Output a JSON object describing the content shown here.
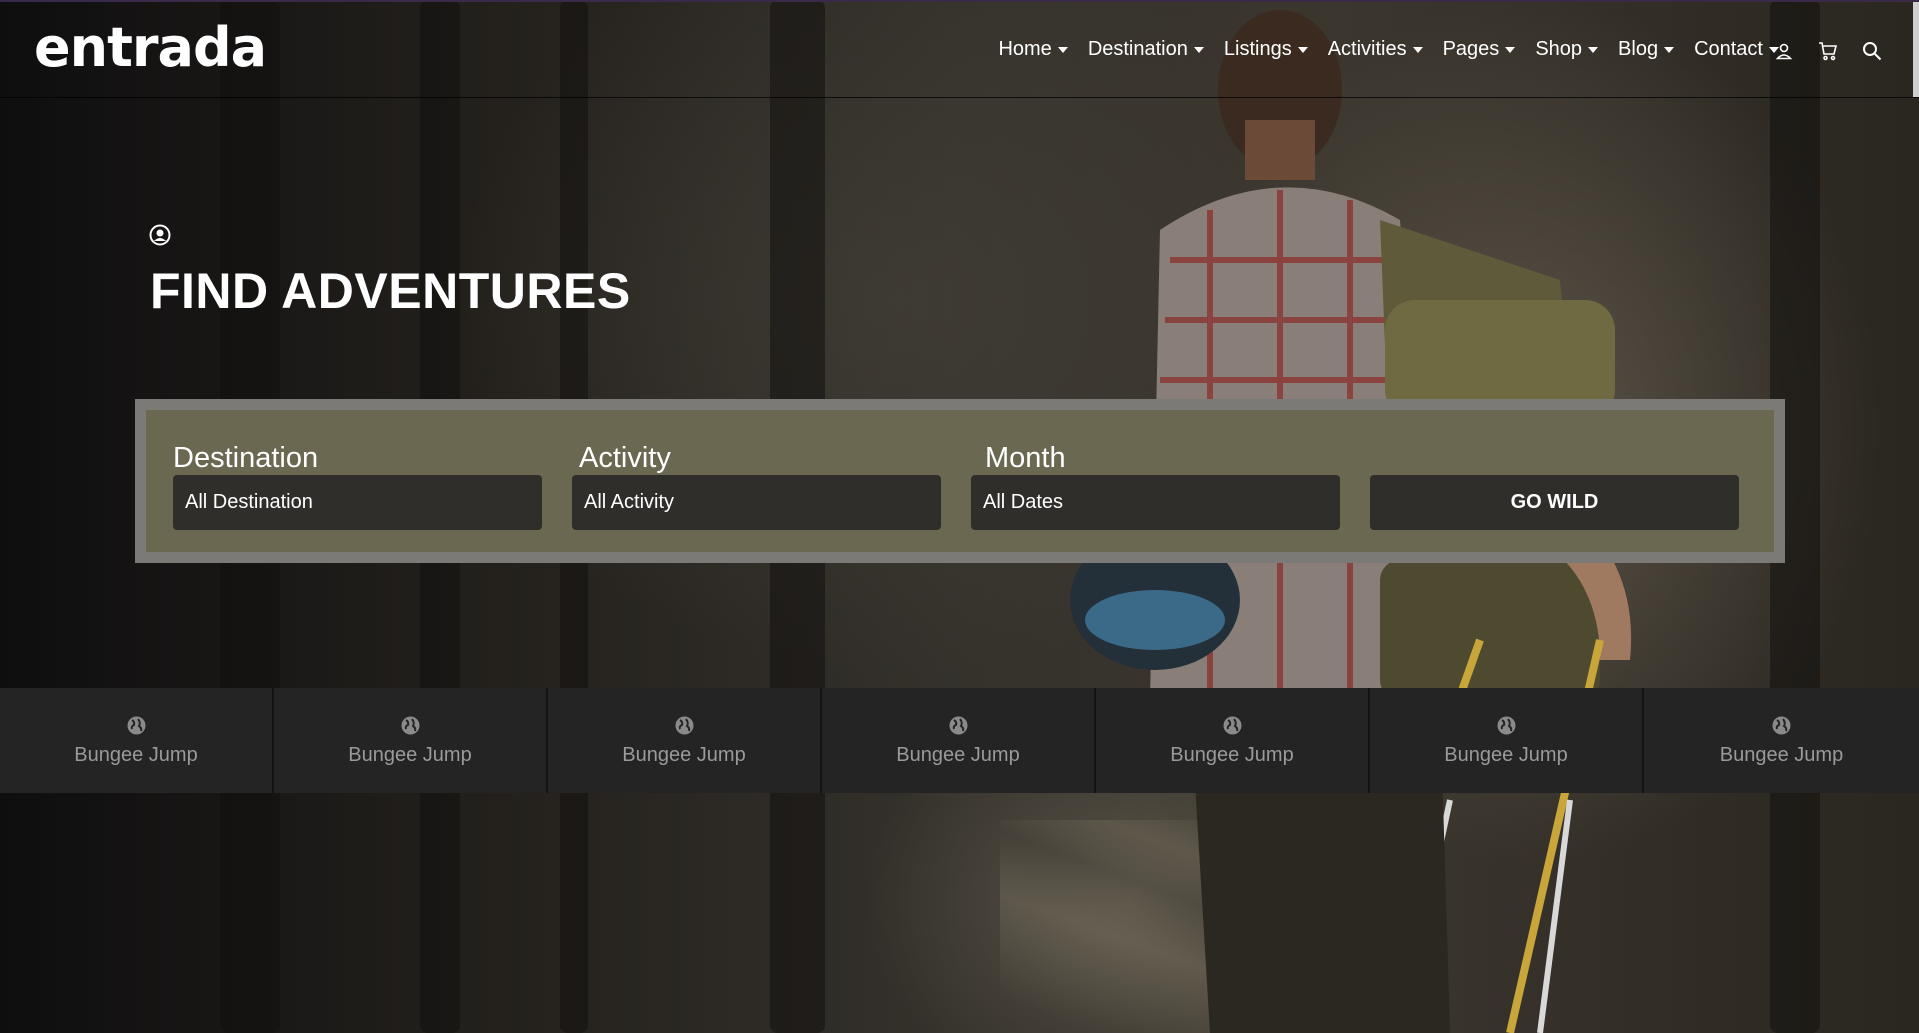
{
  "brand": {
    "logo_text": "entrada"
  },
  "nav": {
    "items": [
      {
        "label": "Home"
      },
      {
        "label": "Destination"
      },
      {
        "label": "Listings"
      },
      {
        "label": "Activities"
      },
      {
        "label": "Pages"
      },
      {
        "label": "Shop"
      },
      {
        "label": "Blog"
      },
      {
        "label": "Contact"
      }
    ],
    "icons": [
      "user-icon",
      "cart-icon",
      "search-icon"
    ]
  },
  "hero": {
    "icon": "user-circle-icon",
    "title": "FIND ADVENTURES"
  },
  "search": {
    "destination": {
      "label": "Destination",
      "value": "All Destination"
    },
    "activity": {
      "label": "Activity",
      "value": "All Activity"
    },
    "month": {
      "label": "Month",
      "value": "All Dates"
    },
    "submit_label": "GO WILD"
  },
  "activities": {
    "icon": "globe-icon",
    "tiles": [
      {
        "label": "Bungee Jump"
      },
      {
        "label": "Bungee Jump"
      },
      {
        "label": "Bungee Jump"
      },
      {
        "label": "Bungee Jump"
      },
      {
        "label": "Bungee Jump"
      },
      {
        "label": "Bungee Jump"
      },
      {
        "label": "Bungee Jump"
      }
    ]
  },
  "colors": {
    "search_panel": "#6b6852",
    "search_frame": "#7b7a76",
    "field_bg": "#2f2e2b",
    "activity_tile_bg": "#242424",
    "activity_text": "#9a9a9a"
  }
}
